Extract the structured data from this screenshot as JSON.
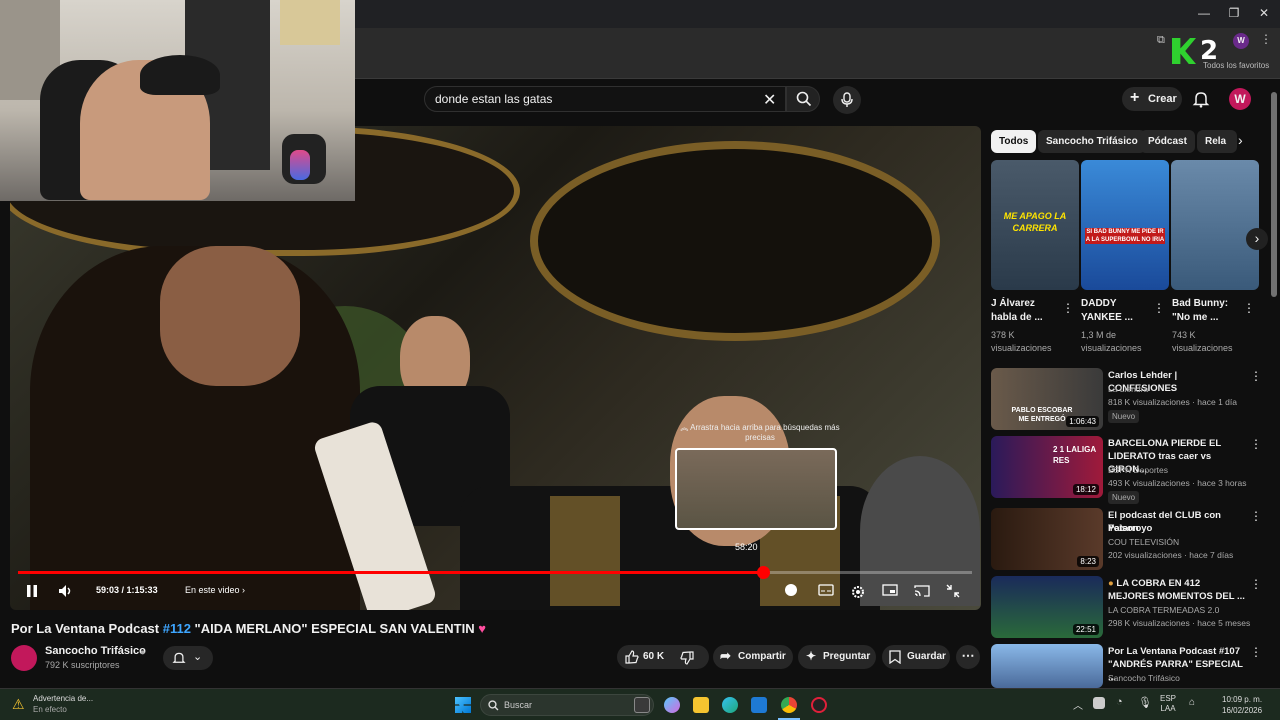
{
  "browser": {
    "profile_initial": "W",
    "favorites_label": "Todos los favoritos",
    "overlay_logo": "2"
  },
  "header": {
    "search_value": "donde estan las gatas",
    "create_label": "Crear",
    "avatar_initial": "W"
  },
  "player": {
    "time_current": "59:03",
    "time_total": "1:15:33",
    "chapter_label": "En este video",
    "preview_hint": "Arrastra hacia arriba para búsquedas más precisas",
    "preview_time": "58:20",
    "progress": 0.781
  },
  "video": {
    "title_prefix": "Por La Ventana Podcast ",
    "title_hashtag": "#112",
    "title_rest": " \"AIDA MERLANO\" ESPECIAL SAN VALENTIN",
    "channel_name": "Sancocho Trifásico",
    "subscribers": "792 K suscriptores",
    "likes": "60 K",
    "share_label": "Compartir",
    "ask_label": "Preguntar",
    "save_label": "Guardar"
  },
  "chips": [
    "Todos",
    "Sancocho Trifásico",
    "Pódcast",
    "Rela"
  ],
  "shorts": [
    {
      "title_1": "J Álvarez",
      "title_2": "habla de ...",
      "views_1": "378 K",
      "views_2": "visualizaciones",
      "caption": "ME APAGO LA CARRERA"
    },
    {
      "title_1": "DADDY",
      "title_2": "YANKEE ...",
      "views_1": "1,3 M de",
      "views_2": "visualizaciones",
      "caption": "SI BAD BUNNY ME PIDE IR A LA SUPERBOWL NO IRIA"
    },
    {
      "title_1": "Bad Bunny:",
      "title_2": "\"No me ...",
      "views_1": "743 K",
      "views_2": "visualizaciones",
      "caption": ""
    }
  ],
  "recommendations": [
    {
      "title_1": "Carlos Lehder | CONFESIONES",
      "title_2": "",
      "channel": "La Liendra",
      "meta": "818 K visualizaciones · hace 1 día",
      "duration": "1:06:43",
      "badge": "Nuevo",
      "thumb_text": "PABLO ESCOBAR ME ENTREGÓ"
    },
    {
      "title_1": "BARCELONA PIERDE EL",
      "title_2": "LIDERATO tras caer vs GIRON...",
      "channel": "ESPN Deportes",
      "meta": "493 K visualizaciones · hace 3 horas",
      "duration": "18:12",
      "badge": "Nuevo",
      "thumb_text": "2 1 LALIGA RES"
    },
    {
      "title_1": "El podcast del CLUB  con Yeison",
      "title_2": "Patarroyo",
      "channel": "COU TELEVISIÓN",
      "meta": "202 visualizaciones · hace 7 días",
      "duration": "8:23",
      "badge": "",
      "thumb_text": ""
    },
    {
      "title_1": "LA COBRA EN 412",
      "title_2": "MEJORES MOMENTOS DEL ...",
      "channel": "LA COBRA TERMEADAS 2.0",
      "meta": "298 K visualizaciones · hace 5 meses",
      "duration": "22:51",
      "badge": "",
      "thumb_text": ""
    },
    {
      "title_1": "Por La Ventana Podcast #107",
      "title_2": "\"ANDRÉS PARRA\" ESPECIAL ...",
      "channel": "Sancocho Trifásico",
      "meta": "",
      "duration": "",
      "badge": "",
      "thumb_text": ""
    }
  ],
  "taskbar": {
    "warning_title": "Advertencia de...",
    "warning_sub": "En efecto",
    "search_placeholder": "Buscar",
    "lang_1": "ESP",
    "lang_2": "LAA",
    "time": "10:09 p. m.",
    "date": "16/02/2026"
  },
  "colors": {
    "accent": "#ff0000",
    "hashtag": "#3ea6ff",
    "background": "#0f0f0f"
  }
}
